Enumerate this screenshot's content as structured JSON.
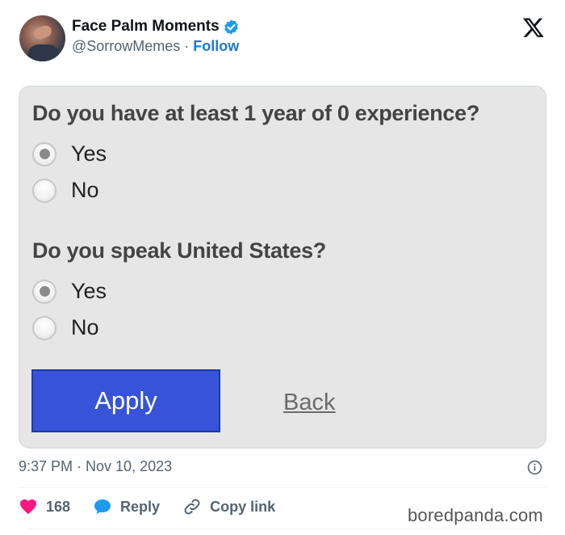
{
  "tweet": {
    "author_name": "Face Palm Moments",
    "handle": "@SorrowMemes",
    "separator": "·",
    "follow_label": "Follow",
    "timestamp": "9:37 PM · Nov 10, 2023"
  },
  "form": {
    "question1": "Do you have at least 1 year of 0 experience?",
    "q1_options": [
      {
        "label": "Yes",
        "selected": true
      },
      {
        "label": "No",
        "selected": false
      }
    ],
    "question2": "Do you speak United States?",
    "q2_options": [
      {
        "label": "Yes",
        "selected": true
      },
      {
        "label": "No",
        "selected": false
      }
    ],
    "apply_label": "Apply",
    "back_label": "Back"
  },
  "actions": {
    "likes": "168",
    "reply_label": "Reply",
    "copy_label": "Copy link"
  },
  "watermark": "boredpanda.com",
  "colors": {
    "verified": "#1d9bf0",
    "follow": "#1d79c9",
    "like": "#f91880",
    "reply": "#1d9bf0",
    "apply_bg": "#3653d9"
  },
  "icons": [
    "avatar",
    "verified-badge-icon",
    "x-logo-icon",
    "info-icon",
    "heart-icon",
    "reply-bubble-icon",
    "link-icon"
  ]
}
